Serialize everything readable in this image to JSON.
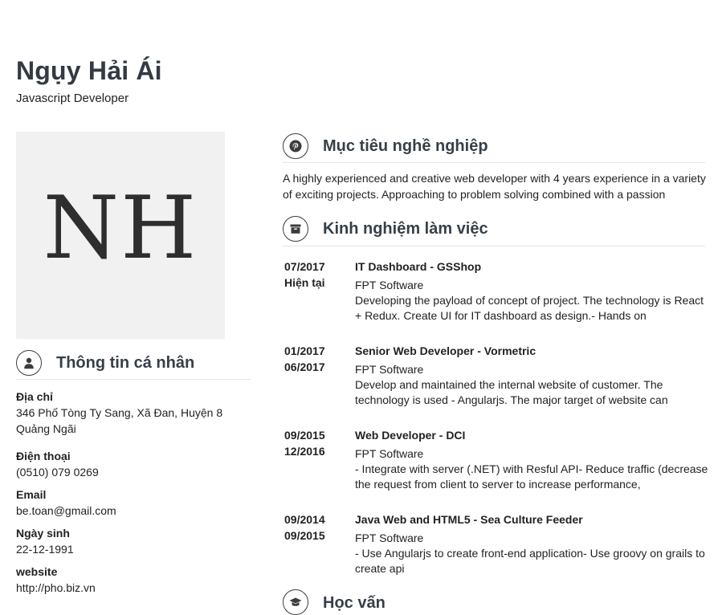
{
  "profile": {
    "name": "Ngụy Hải Ái",
    "role": "Javascript Developer",
    "initials": "NH"
  },
  "personal": {
    "heading": "Thông tin cá nhân",
    "icon": "user-icon",
    "fields": [
      {
        "label": "Địa chỉ",
        "value": "346 Phố Tòng Ty Sang, Xã Đan, Huyện 8 Quảng Ngãi"
      },
      {
        "label": "Điện thoại",
        "value": "(0510) 079 0269"
      },
      {
        "label": "Email",
        "value": "be.toan@gmail.com"
      },
      {
        "label": "Ngày sinh",
        "value": "22-12-1991"
      },
      {
        "label": "website",
        "value": "http://pho.biz.vn"
      }
    ]
  },
  "objective": {
    "heading": "Mục tiêu nghề nghiệp",
    "icon": "pinterest-icon",
    "text": "A highly experienced and creative web developer with 4 years experience in a variety of exciting projects. Approaching to problem solving combined with a passion"
  },
  "experience": {
    "heading": "Kinh nghiệm làm việc",
    "icon": "briefcase-icon",
    "jobs": [
      {
        "start": "07/2017",
        "end": "Hiện tại",
        "title": "IT Dashboard - GSShop",
        "company": "FPT Software",
        "desc": "Developing the payload of concept of project. The technology is React + Redux. Create UI for IT dashboard as design.- Hands on"
      },
      {
        "start": "01/2017",
        "end": "06/2017",
        "title": "Senior Web Developer - Vormetric",
        "company": "FPT Software",
        "desc": "Develop and maintained the internal website of customer. The technology is used - Angularjs. The major target of website can"
      },
      {
        "start": "09/2015",
        "end": "12/2016",
        "title": "Web Developer - DCI",
        "company": "FPT Software",
        "desc": "- Integrate with server (.NET) with Resful API- Reduce traffic (decrease the request from client to server to increase performance,"
      },
      {
        "start": "09/2014",
        "end": "09/2015",
        "title": "Java Web and HTML5 - Sea Culture Feeder",
        "company": "FPT Software",
        "desc": "- Use Angularjs to create front-end application- Use groovy on grails to create api"
      }
    ]
  },
  "next_section": {
    "heading": "Học vấn",
    "icon": "graduation-cap-icon"
  }
}
